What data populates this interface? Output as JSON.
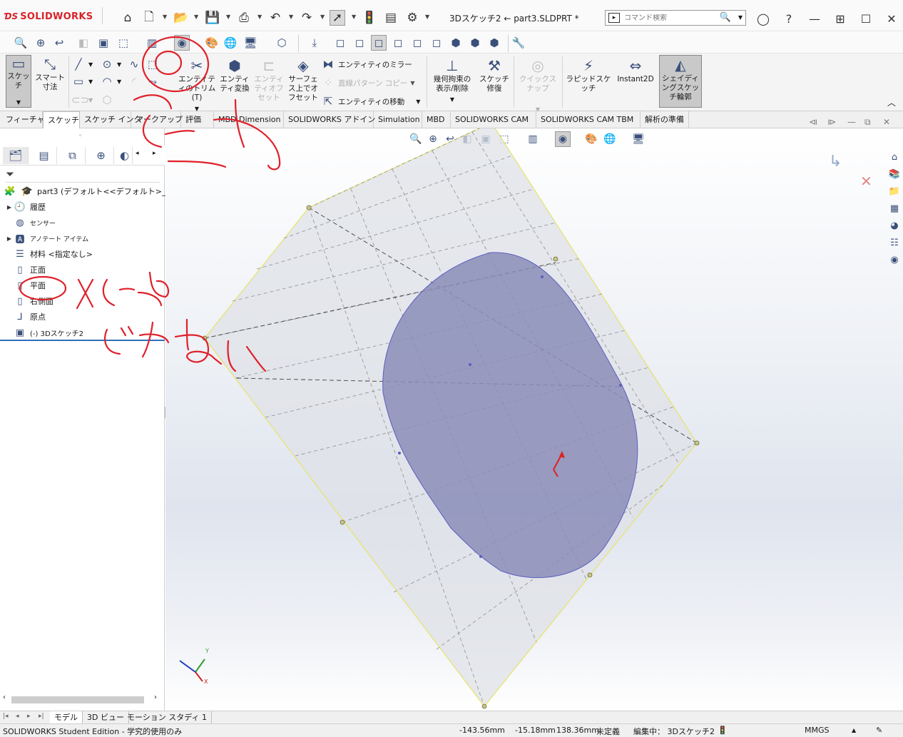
{
  "app": {
    "brand": "SOLIDWORKS",
    "window_title": "3Dスケッチ2 ← part3.SLDPRT *",
    "search_placeholder": "コマンド検索"
  },
  "command_manager": {
    "sketch": "スケッチ",
    "smart_dimension": "スマート寸法",
    "trim_entities": "エンティティのトリム(T)",
    "convert_entities": "エンティティ変換",
    "offset_entities": "エンティティオフセット",
    "offset_on_surface": "サーフェス上でオフセット",
    "mirror_entities": "エンティティのミラー",
    "linear_pattern": "直線パターン コピー",
    "move_entities": "エンティティの移動",
    "display_delete_relations": "幾何拘束の表示/削除",
    "repair_sketch": "スケッチ修復",
    "quick_snaps": "クイックスナップ",
    "rapid_sketch": "ラピッドスケッチ",
    "instant2d": "Instant2D",
    "shaded_sketch_contours": "シェイディングスケッチ輪郭"
  },
  "tabs": [
    "フィーチャー",
    "スケッチ",
    "スケッチ インク",
    "マークアップ",
    "評価",
    "MBD Dimension",
    "SOLIDWORKS アドイン",
    "Simulation",
    "MBD",
    "SOLIDWORKS CAM",
    "SOLIDWORKS CAM TBM",
    "解析の準備"
  ],
  "tree": {
    "root": "part3 (デフォルト<<デフォルト>_表示状",
    "items": [
      "履歴",
      "センサー",
      "アノテート アイテム",
      "材料 <指定なし>",
      "正面",
      "平面",
      "右側面",
      "原点",
      "(-) 3Dスケッチ2"
    ]
  },
  "bottom_tabs": [
    "モデル",
    "3D ビュー",
    "モーション スタディ 1"
  ],
  "status": {
    "edition": "SOLIDWORKS Student Edition - 学究的使用のみ",
    "x": "-143.56mm",
    "y": "-15.18mm",
    "z": "138.36mm",
    "state": "未定義",
    "editing": "編集中： 3Dスケッチ2",
    "units": "MMGS"
  },
  "annotations": {
    "handwritten": [
      "こっち",
      "×こっち",
      "じゃない"
    ]
  },
  "colors": {
    "brand_red": "#d8232a",
    "sketch_fill": "#8c8fb8",
    "plane_edge": "#e8e36a",
    "markup_red": "#e0202a",
    "tree_rule_blue": "#2f6fb9"
  }
}
